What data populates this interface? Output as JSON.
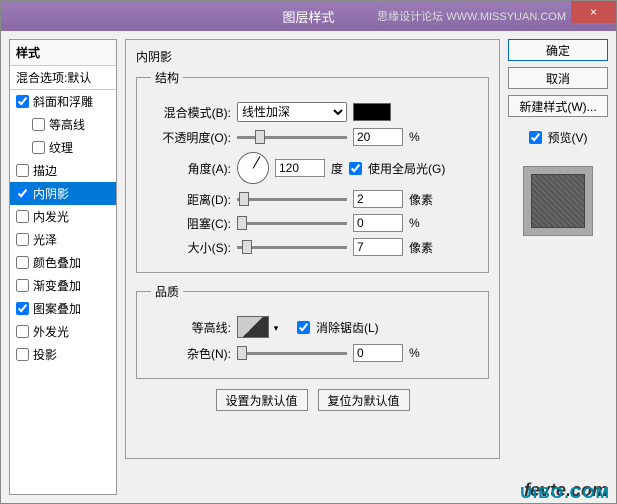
{
  "title": "图层样式",
  "watermark_top": "思缘设计论坛 WWW.MISSYUAN.COM",
  "close": "×",
  "style_list": {
    "header": "样式",
    "blend": "混合选项:默认",
    "items": [
      {
        "label": "斜面和浮雕",
        "checked": true,
        "sel": false,
        "indent": false
      },
      {
        "label": "等高线",
        "checked": false,
        "sel": false,
        "indent": true
      },
      {
        "label": "纹理",
        "checked": false,
        "sel": false,
        "indent": true
      },
      {
        "label": "描边",
        "checked": false,
        "sel": false,
        "indent": false
      },
      {
        "label": "内阴影",
        "checked": true,
        "sel": true,
        "indent": false
      },
      {
        "label": "内发光",
        "checked": false,
        "sel": false,
        "indent": false
      },
      {
        "label": "光泽",
        "checked": false,
        "sel": false,
        "indent": false
      },
      {
        "label": "颜色叠加",
        "checked": false,
        "sel": false,
        "indent": false
      },
      {
        "label": "渐变叠加",
        "checked": false,
        "sel": false,
        "indent": false
      },
      {
        "label": "图案叠加",
        "checked": true,
        "sel": false,
        "indent": false
      },
      {
        "label": "外发光",
        "checked": false,
        "sel": false,
        "indent": false
      },
      {
        "label": "投影",
        "checked": false,
        "sel": false,
        "indent": false
      }
    ]
  },
  "panel": {
    "title": "内阴影",
    "structure": {
      "legend": "结构",
      "blend_mode_label": "混合模式(B):",
      "blend_mode_value": "线性加深",
      "opacity_label": "不透明度(O):",
      "opacity_value": "20",
      "opacity_unit": "%",
      "angle_label": "角度(A):",
      "angle_value": "120",
      "angle_unit": "度",
      "global_light_label": "使用全局光(G)",
      "distance_label": "距离(D):",
      "distance_value": "2",
      "distance_unit": "像素",
      "choke_label": "阻塞(C):",
      "choke_value": "0",
      "choke_unit": "%",
      "size_label": "大小(S):",
      "size_value": "7",
      "size_unit": "像素"
    },
    "quality": {
      "legend": "品质",
      "contour_label": "等高线:",
      "antialias_label": "消除锯齿(L)",
      "noise_label": "杂色(N):",
      "noise_value": "0",
      "noise_unit": "%"
    },
    "defaults": {
      "set": "设置为默认值",
      "reset": "复位为默认值"
    }
  },
  "buttons": {
    "ok": "确定",
    "cancel": "取消",
    "new_style": "新建样式(W)...",
    "preview": "预览(V)"
  },
  "footer1": "fevte.com",
  "footer2": "UiBO.COM"
}
